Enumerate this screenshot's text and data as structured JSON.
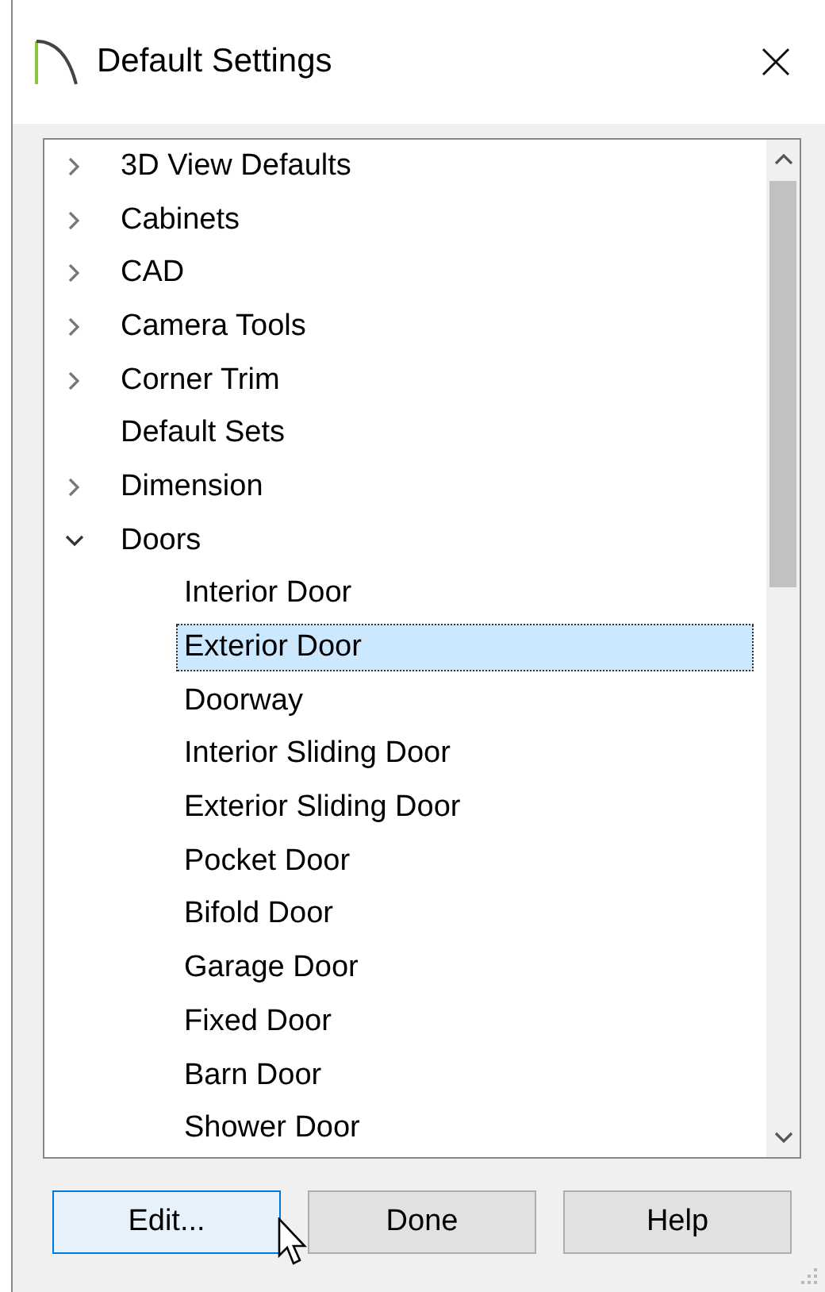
{
  "window": {
    "title": "Default Settings"
  },
  "tree": [
    {
      "label": "3D View Defaults",
      "expanded": false,
      "selected": false
    },
    {
      "label": "Cabinets",
      "expanded": false,
      "selected": false
    },
    {
      "label": "CAD",
      "expanded": false,
      "selected": false
    },
    {
      "label": "Camera Tools",
      "expanded": false,
      "selected": false
    },
    {
      "label": "Corner Trim",
      "expanded": false,
      "selected": false
    },
    {
      "label": "Default Sets",
      "selected": false
    },
    {
      "label": "Dimension",
      "expanded": false,
      "selected": false
    },
    {
      "label": "Doors",
      "expanded": true,
      "selected": false,
      "children": [
        {
          "label": "Interior Door",
          "selected": false
        },
        {
          "label": "Exterior Door",
          "selected": true
        },
        {
          "label": "Doorway",
          "selected": false
        },
        {
          "label": "Interior Sliding Door",
          "selected": false
        },
        {
          "label": "Exterior Sliding Door",
          "selected": false
        },
        {
          "label": "Pocket Door",
          "selected": false
        },
        {
          "label": "Bifold Door",
          "selected": false
        },
        {
          "label": "Garage Door",
          "selected": false
        },
        {
          "label": "Fixed Door",
          "selected": false
        },
        {
          "label": "Barn Door",
          "selected": false
        },
        {
          "label": "Shower Door",
          "selected": false
        }
      ]
    }
  ],
  "buttons": [
    {
      "label": "Edit...",
      "hovered": true
    },
    {
      "label": "Done",
      "hovered": false
    },
    {
      "label": "Help",
      "hovered": false
    }
  ]
}
